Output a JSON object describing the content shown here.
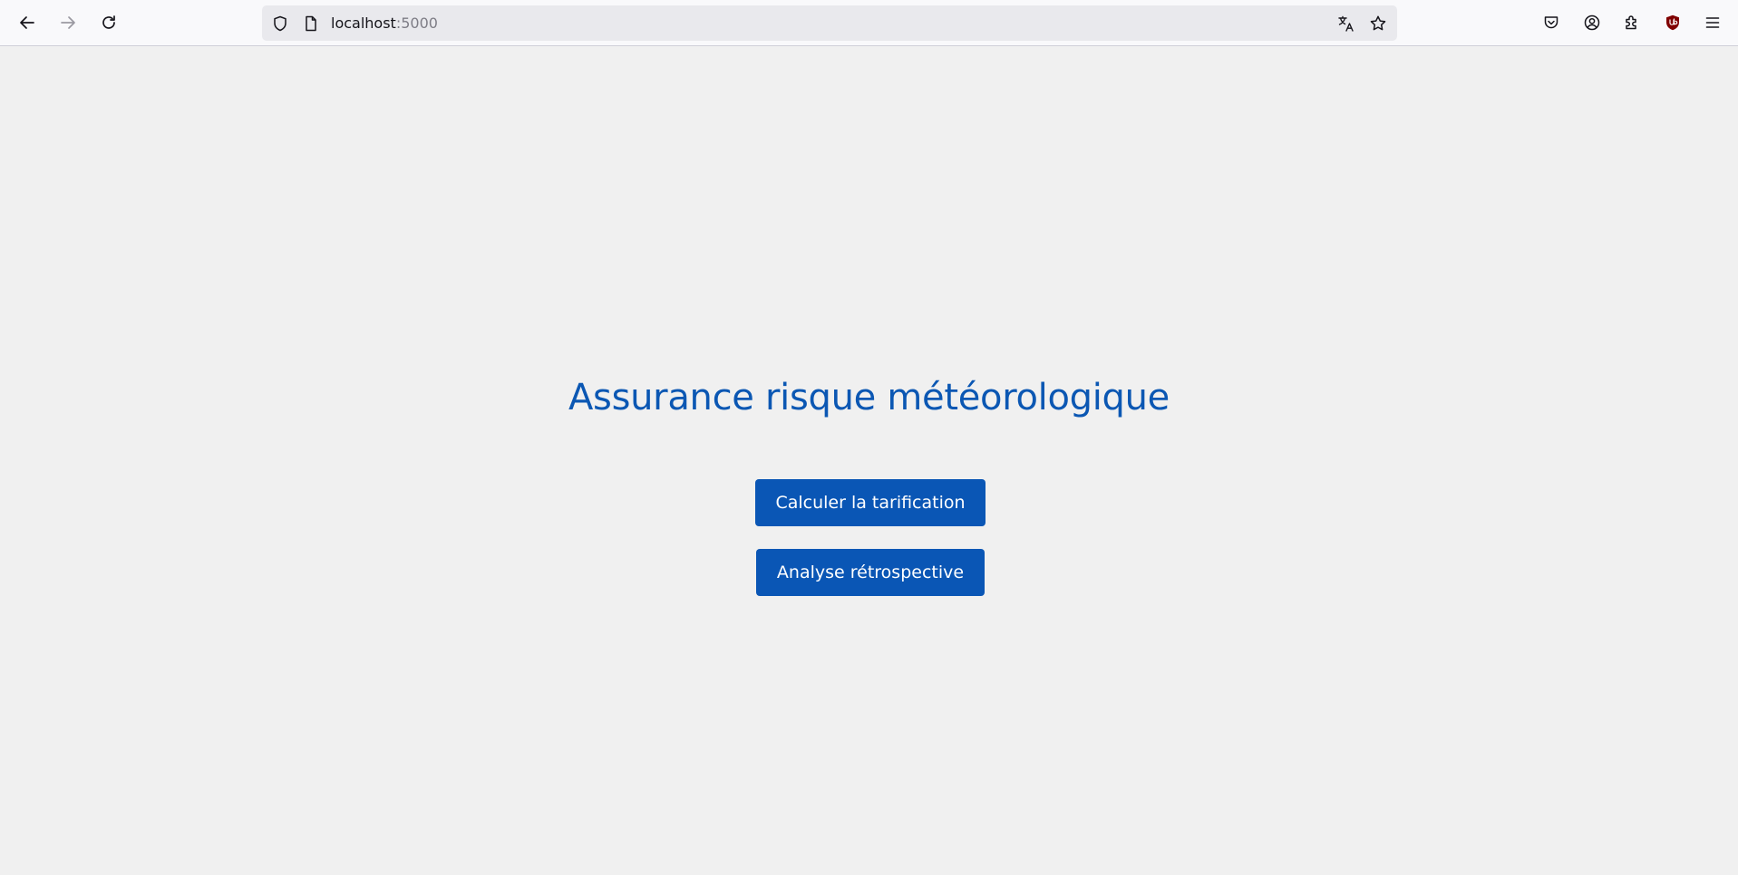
{
  "browser": {
    "url_host": "localhost",
    "url_port": ":5000",
    "icons": {
      "back": "arrow-left-icon",
      "forward": "arrow-right-icon",
      "reload": "reload-icon",
      "shield": "tracking-protection-shield-icon",
      "page": "page-icon",
      "translate": "translate-icon",
      "bookmark": "star-icon",
      "pocket": "pocket-icon",
      "account": "account-icon",
      "extensions": "extensions-puzzle-icon",
      "ublock": "ublock-origin-icon",
      "menu": "hamburger-menu-icon"
    }
  },
  "page": {
    "title": "Assurance risque météorologique",
    "buttons": {
      "calc_label": "Calculer la tarification",
      "retro_label": "Analyse rétrospective"
    }
  },
  "colors": {
    "accent": "#0b57b3",
    "button_bg": "#0a56b5",
    "page_bg": "#f0f0f0",
    "ublock": "#800000"
  }
}
